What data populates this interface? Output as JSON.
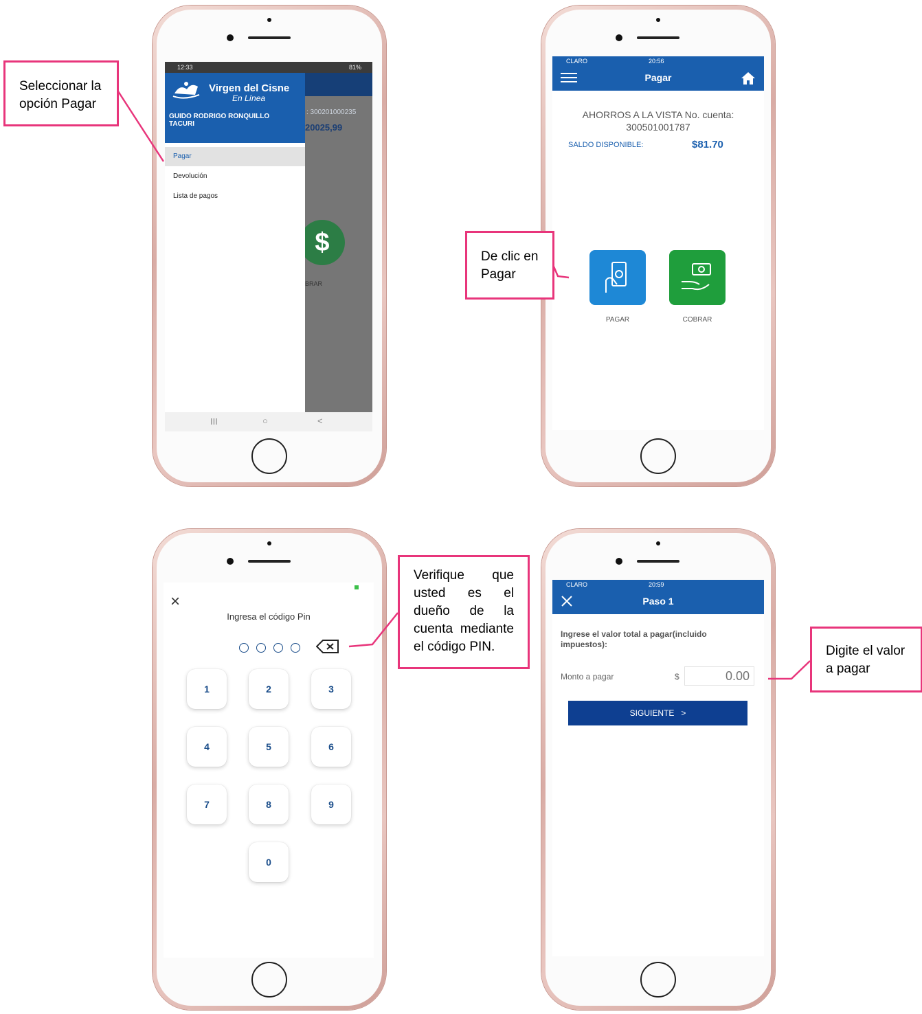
{
  "callouts": {
    "c1": "Seleccionar la opción Pagar",
    "c2": "De clic en Pagar",
    "c3": "Verifique que usted es el dueño de la cuenta mediante el código PIN.",
    "c4": "Digite el valor a pagar"
  },
  "screen1": {
    "status_time": "12:33",
    "status_right": "81%",
    "brand_title": "Virgen del Cisne",
    "brand_subtitle": "En Línea",
    "user_name_line1": "GUIDO RODRIGO RONQUILLO",
    "user_name_line2": "TACURI",
    "bg_account": ": 300201000235",
    "bg_amount": "20025,99",
    "bg_cobrar": "BRAR",
    "menu_items": [
      "Pagar",
      "Devolución",
      "Lista de pagos"
    ],
    "nav": [
      "III",
      "○",
      "<"
    ]
  },
  "screen2": {
    "carrier": "CLARO",
    "time": "20:56",
    "title": "Pagar",
    "account_line1": "AHORROS A LA VISTA No. cuenta:",
    "account_line2": "300501001787",
    "balance_label": "SALDO DISPONIBLE:",
    "balance_value": "$81.70",
    "pagar_label": "PAGAR",
    "cobrar_label": "COBRAR",
    "colors": {
      "pagar_tile": "#1e88d6",
      "cobrar_tile": "#1f9e3c",
      "header": "#1a5fae"
    }
  },
  "screen3": {
    "close": "×",
    "prompt": "Ingresa el código Pin",
    "keys": [
      "1",
      "2",
      "3",
      "4",
      "5",
      "6",
      "7",
      "8",
      "9",
      "0"
    ]
  },
  "screen4": {
    "carrier": "CLARO",
    "time": "20:59",
    "title": "Paso 1",
    "prompt_line1": "Ingrese el valor total a pagar(incluido",
    "prompt_line2": "impuestos):",
    "amount_label": "Monto a pagar",
    "currency": "$",
    "amount_placeholder": "0.00",
    "next_button": "SIGUIENTE   >",
    "colors": {
      "button": "#0e3f91"
    }
  }
}
